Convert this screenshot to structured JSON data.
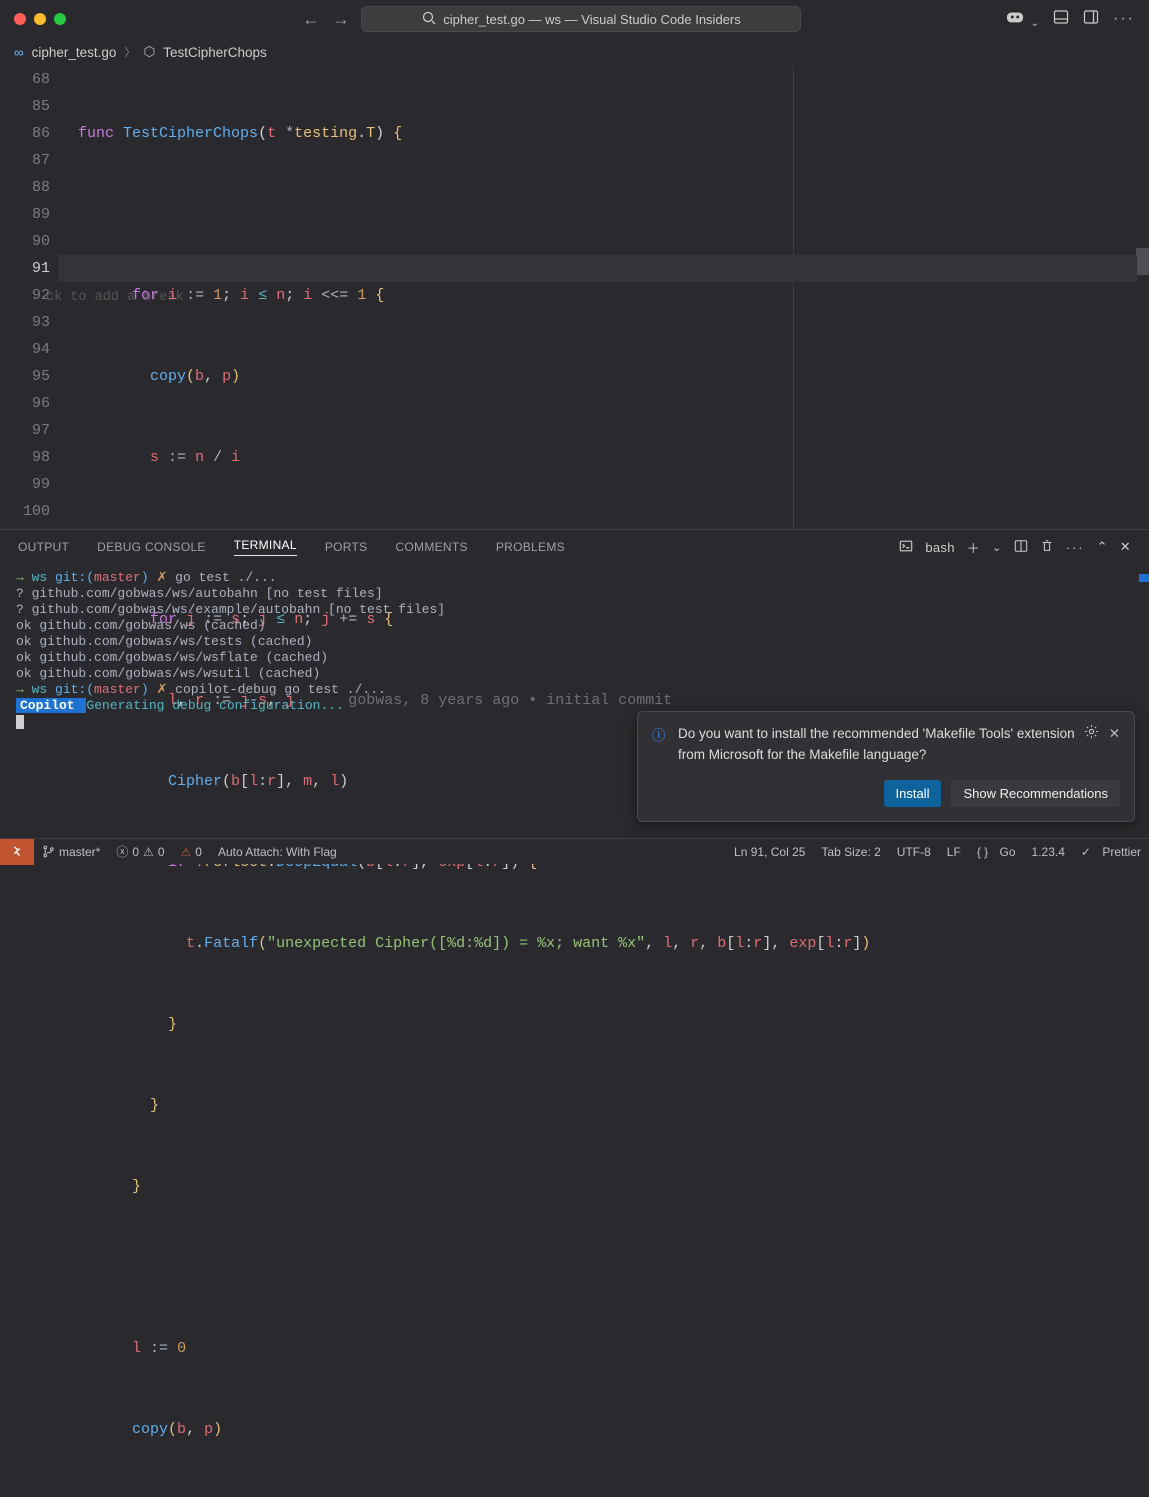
{
  "titlebar": {
    "back": "←",
    "fwd": "→",
    "search_icon": "⌕",
    "title": "cipher_test.go — ws — Visual Studio Code Insiders"
  },
  "breadcrumb": {
    "file_icon": "∞",
    "file": "cipher_test.go",
    "symbol_icon": "⬡",
    "symbol": "TestCipherChops"
  },
  "editor": {
    "sticky_line_no": "68",
    "line_numbers": [
      "85",
      "86",
      "87",
      "88",
      "89",
      "90",
      "91",
      "92",
      "93",
      "94",
      "95",
      "96",
      "97",
      "98",
      "99",
      "100"
    ],
    "bp_hint": "ck to add a break",
    "blame": "gobwas, 8 years ago • initial commit",
    "code": {
      "l68_func": "func",
      "l68_name": "TestCipherChops",
      "l68_sig_open": "(",
      "l68_t": "t",
      "l68_star": "*",
      "l68_pkg": "testing",
      "l68_dot": ".",
      "l68_type": "T",
      "l68_sig_close": ")",
      "l68_brace": "{",
      "l86_for": "for",
      "l86_i": "i",
      "l86_assign": ":=",
      "l86_one": "1",
      "l86_semi": ";",
      "l86_le": "≤",
      "l86_n": "n",
      "l86_shift": "<<=",
      "l86_one2": "1",
      "l86_brace": "{",
      "l87_copy": "copy",
      "l87_open": "(",
      "l87_b": "b",
      "l87_comma": ", ",
      "l87_p": "p",
      "l87_close": ")",
      "l88_s": "s",
      "l88_assign": ":=",
      "l88_n": "n",
      "l88_div": "/",
      "l88_i": "i",
      "l90_for": "for",
      "l90_j": "j",
      "l90_assign": ":=",
      "l90_s": "s",
      "l90_le": "≤",
      "l90_n": "n",
      "l90_plus": "+=",
      "l90_brace": "{",
      "l91_l": "l",
      "l91_r": "r",
      "l91_assign": ":=",
      "l91_expr": "j-s, j",
      "l92_fn": "Cipher",
      "l92_args": "(b[l:r], m, l)",
      "l93_if": "if",
      "l93_not": "!",
      "l93_reflect": "reflect",
      "l93_de": "DeepEqual",
      "l93_args": "(b[l:r], exp[l:r])",
      "l93_brace": "{",
      "l94_t": "t",
      "l94_fatal": "Fatalf",
      "l94_open": "(",
      "l94_str": "\"unexpected Cipher([%d:%d]) = %x; want %x\"",
      "l94_rest": ", l, r, b[l:r], exp[l:r])",
      "l95": "}",
      "l96": "}",
      "l97": "}",
      "l99_l": "l",
      "l99_assign": ":=",
      "l99_zero": "0",
      "l100_copy": "copy",
      "l100_args": "(b, p)"
    }
  },
  "panel": {
    "tabs": [
      "OUTPUT",
      "DEBUG CONSOLE",
      "TERMINAL",
      "PORTS",
      "COMMENTS",
      "PROBLEMS"
    ],
    "active_index": 2,
    "shell": "bash"
  },
  "terminal": {
    "l1_arrow": "→ ",
    "l1_ws": "ws",
    "l1_git": " git:(",
    "l1_branch": "master",
    "l1_gitc": ") ",
    "l1_x": "✗",
    "l1_cmd": " go test ./...",
    "l2": "?       github.com/gobwas/ws/autobahn   [no test files]",
    "l3": "?       github.com/gobwas/ws/example/autobahn   [no test files]",
    "l4": "ok      github.com/gobwas/ws    (cached)",
    "l5": "ok      github.com/gobwas/ws/tests      (cached)",
    "l6": "ok      github.com/gobwas/ws/wsflate    (cached)",
    "l7": "ok      github.com/gobwas/ws/wsutil     (cached)",
    "l8_cmd": " copilot-debug go test ./...",
    "l9_badge": " Copilot ",
    "l9_msg": "Generating debug configuration..."
  },
  "toast": {
    "text": "Do you want to install the recommended 'Makefile Tools' extension from Microsoft for the Makefile language?",
    "install": "Install",
    "show_rec": "Show Recommendations"
  },
  "status": {
    "branch": "master*",
    "errors": "0",
    "warnings": "0",
    "w_orange": "0",
    "auto_attach": "Auto Attach: With Flag",
    "lncol": "Ln 91, Col 25",
    "tabsize": "Tab Size: 2",
    "encoding": "UTF-8",
    "eol": "LF",
    "lang": "Go",
    "gover": "1.23.4",
    "prettier": "Prettier"
  }
}
